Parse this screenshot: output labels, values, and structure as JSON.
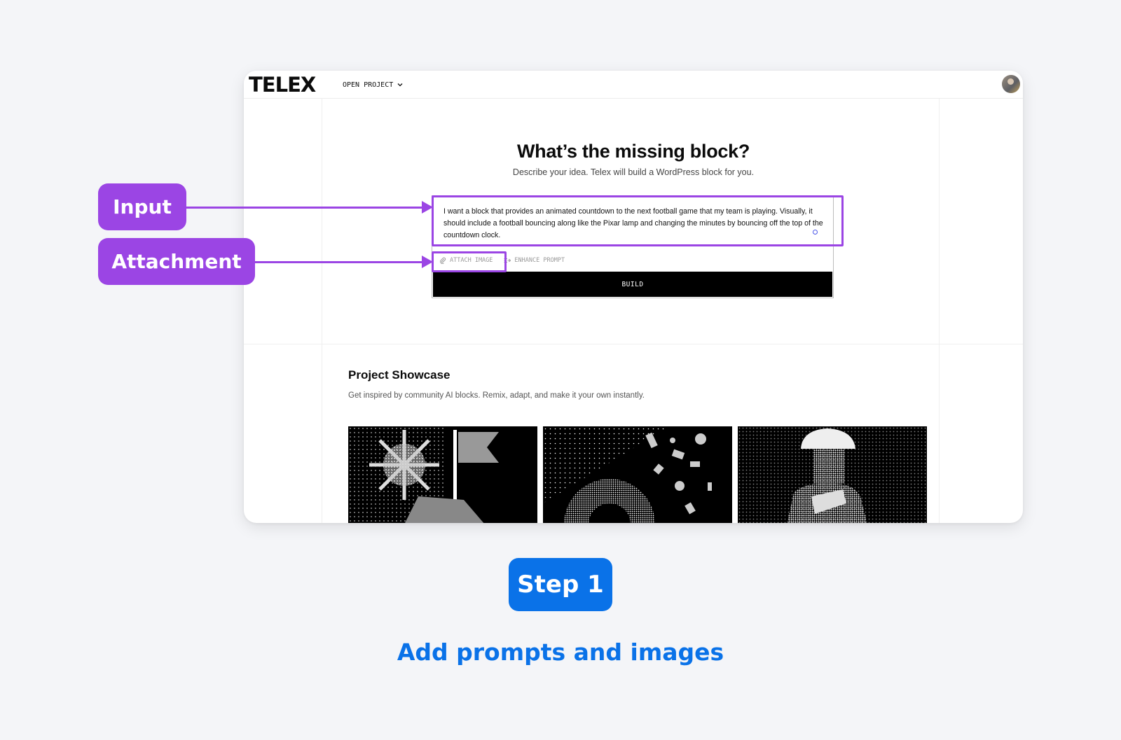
{
  "app": {
    "logo": "TELEX",
    "open_project_label": "OPEN PROJECT"
  },
  "hero": {
    "title": "What’s the missing block?",
    "subtitle": "Describe your idea. Telex will build a WordPress block for you."
  },
  "prompt": {
    "value": "I want a block that provides an animated countdown to the next football game that my team is playing. Visually, it should include a football bouncing along like the Pixar lamp and changing the minutes by bouncing off the top of the countdown clock.",
    "attach_label": "ATTACH IMAGE",
    "enhance_label": "ENHANCE PROMPT",
    "build_label": "BUILD"
  },
  "showcase": {
    "title": "Project Showcase",
    "subtitle": "Get inspired by community AI blocks. Remix, adapt, and make it your own instantly.",
    "items": [
      {
        "icon": "spiked-ball-flag-image"
      },
      {
        "icon": "arch-confetti-image"
      },
      {
        "icon": "figure-hat-image"
      }
    ]
  },
  "annotations": {
    "input_label": "Input",
    "attachment_label": "Attachment",
    "step_label": "Step 1",
    "step_caption": "Add prompts and images",
    "colors": {
      "callout": "#9b45e4",
      "step": "#0a72e8"
    }
  }
}
